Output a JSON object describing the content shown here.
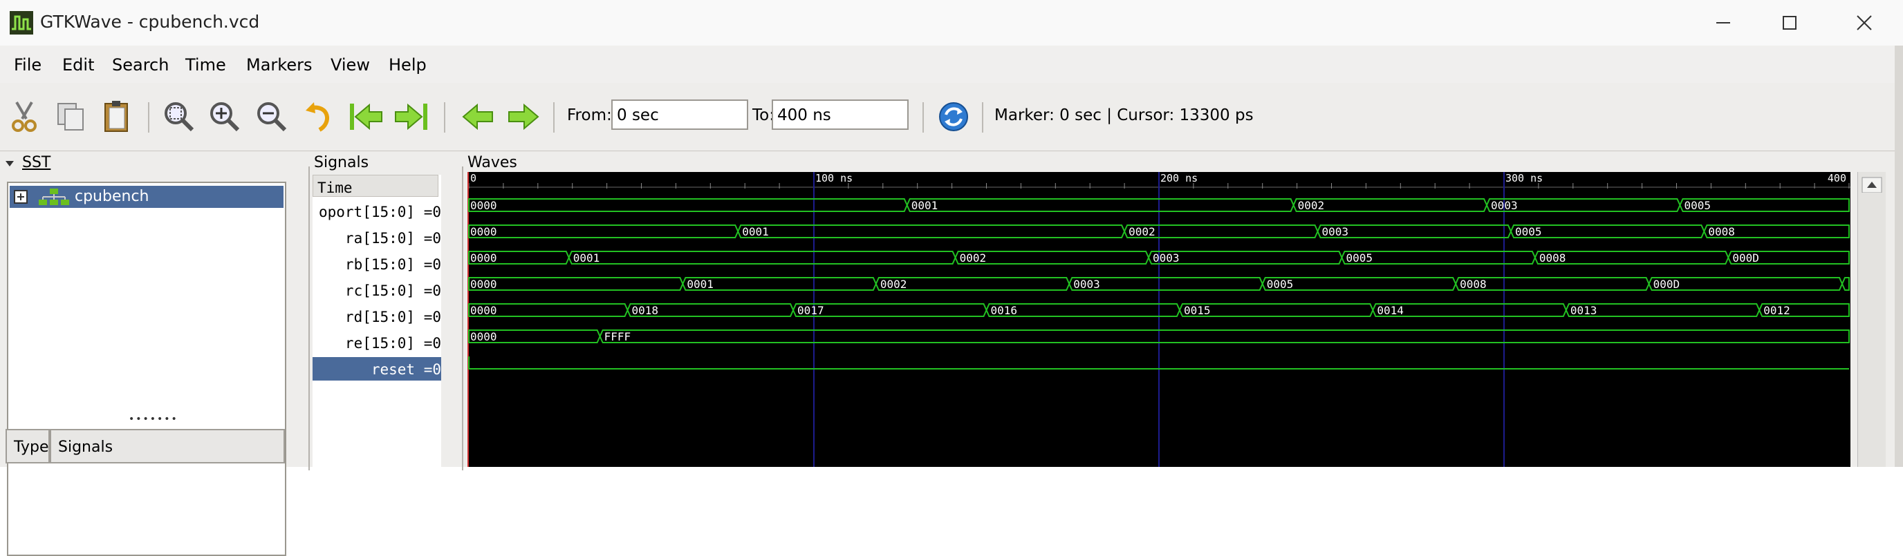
{
  "window": {
    "title": "GTKWave - cpubench.vcd",
    "minimize_glyph": "—",
    "maximize_glyph": "☐",
    "close_glyph": "✕"
  },
  "menu": [
    "File",
    "Edit",
    "Search",
    "Time",
    "Markers",
    "View",
    "Help"
  ],
  "toolbar": {
    "icons": [
      "cut-icon",
      "copy-icon",
      "paste-icon",
      "zoom-fit-icon",
      "zoom-in-icon",
      "zoom-out-icon",
      "undo-zoom-icon",
      "jump-start-icon",
      "jump-end-icon",
      "prev-edge-icon",
      "next-edge-icon",
      "reload-icon"
    ],
    "from_label": "From:",
    "from_value": "0 sec",
    "to_label": "To:",
    "to_value": "400 ns",
    "marker_info": "Marker: 0 sec  |  Cursor: 13300 ps"
  },
  "sst": {
    "title": "SST",
    "tree_item": "cpubench",
    "grip": "•••••••",
    "col_type": "Type",
    "col_signals": "Signals"
  },
  "signals": {
    "title": "Signals",
    "time_label": "Time",
    "rows": [
      {
        "label": "oport[15:0] =0"
      },
      {
        "label": "ra[15:0] =0"
      },
      {
        "label": "rb[15:0] =0"
      },
      {
        "label": "rc[15:0] =0"
      },
      {
        "label": "rd[15:0] =0"
      },
      {
        "label": "re[15:0] =0"
      },
      {
        "label": "reset =0",
        "selected": true
      }
    ]
  },
  "waves": {
    "title": "Waves",
    "time_range_ns": [
      0,
      400
    ],
    "ruler_labels": [
      {
        "t": 0,
        "text": "0"
      },
      {
        "t": 100,
        "text": "100 ns"
      },
      {
        "t": 200,
        "text": "200 ns"
      },
      {
        "t": 300,
        "text": "300 ns"
      },
      {
        "t": 400,
        "text": "400"
      }
    ],
    "colors": {
      "background": "#000000",
      "wave": "#22c022",
      "text": "#ffffff",
      "grid": "#1c1c8c",
      "marker": "#d03030"
    },
    "buses": [
      {
        "name": "oport",
        "segments": [
          {
            "t": 0,
            "v": "0000"
          },
          {
            "t": 127,
            "v": "0001"
          },
          {
            "t": 239,
            "v": "0002"
          },
          {
            "t": 295,
            "v": "0003"
          },
          {
            "t": 351,
            "v": "0005"
          }
        ]
      },
      {
        "name": "ra",
        "segments": [
          {
            "t": 0,
            "v": "0000"
          },
          {
            "t": 78,
            "v": "0001"
          },
          {
            "t": 190,
            "v": "0002"
          },
          {
            "t": 246,
            "v": "0003"
          },
          {
            "t": 302,
            "v": "0005"
          },
          {
            "t": 358,
            "v": "0008"
          }
        ]
      },
      {
        "name": "rb",
        "segments": [
          {
            "t": 0,
            "v": "0000"
          },
          {
            "t": 29,
            "v": "0001"
          },
          {
            "t": 141,
            "v": "0002"
          },
          {
            "t": 197,
            "v": "0003"
          },
          {
            "t": 253,
            "v": "0005"
          },
          {
            "t": 309,
            "v": "0008"
          },
          {
            "t": 365,
            "v": "000D"
          }
        ]
      },
      {
        "name": "rc",
        "segments": [
          {
            "t": 0,
            "v": "0000"
          },
          {
            "t": 62,
            "v": "0001"
          },
          {
            "t": 118,
            "v": "0002"
          },
          {
            "t": 174,
            "v": "0003"
          },
          {
            "t": 230,
            "v": "0005"
          },
          {
            "t": 286,
            "v": "0008"
          },
          {
            "t": 342,
            "v": "000D"
          },
          {
            "t": 398,
            "v": ""
          }
        ]
      },
      {
        "name": "rd",
        "segments": [
          {
            "t": 0,
            "v": "0000"
          },
          {
            "t": 46,
            "v": "0018"
          },
          {
            "t": 94,
            "v": "0017"
          },
          {
            "t": 150,
            "v": "0016"
          },
          {
            "t": 206,
            "v": "0015"
          },
          {
            "t": 262,
            "v": "0014"
          },
          {
            "t": 318,
            "v": "0013"
          },
          {
            "t": 374,
            "v": "0012"
          }
        ]
      },
      {
        "name": "re",
        "segments": [
          {
            "t": 0,
            "v": "0000"
          },
          {
            "t": 38,
            "v": "FFFF"
          }
        ]
      }
    ],
    "bit": {
      "name": "reset",
      "level": 0
    }
  }
}
